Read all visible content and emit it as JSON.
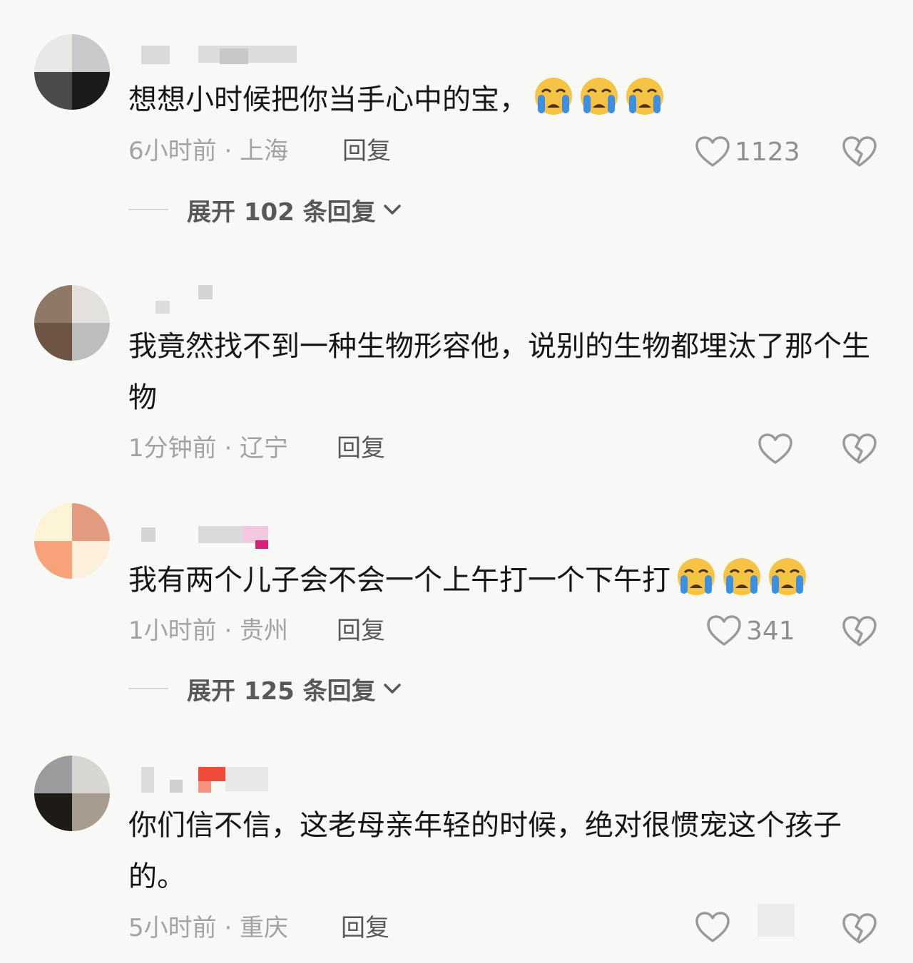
{
  "comments": [
    {
      "text": "想想小时候把你当手心中的宝，",
      "emoji_count": 3,
      "time": "6小时前",
      "location": "上海",
      "meta": "6小时前 · 上海",
      "reply_label": "回复",
      "like_count": "1123",
      "expand_label": "展开 102 条回复"
    },
    {
      "text": "我竟然找不到一种生物形容他，说别的生物都埋汰了那个生物",
      "emoji_count": 0,
      "time": "1分钟前",
      "location": "辽宁",
      "meta": "1分钟前 · 辽宁",
      "reply_label": "回复",
      "like_count": ""
    },
    {
      "text": "我有两个儿子会不会一个上午打一个下午打",
      "emoji_count": 3,
      "time": "1小时前",
      "location": "贵州",
      "meta": "1小时前 · 贵州",
      "reply_label": "回复",
      "like_count": "341",
      "expand_label": "展开 125 条回复"
    },
    {
      "text": "你们信不信，这老母亲年轻的时候，绝对很惯宠这个孩子的。",
      "emoji_count": 0,
      "time": "5小时前",
      "location": "重庆",
      "meta": "5小时前 · 重庆",
      "reply_label": "回复",
      "like_count": ""
    }
  ],
  "icons": {
    "like": "heart-outline-icon",
    "dislike": "broken-heart-icon",
    "expand": "chevron-down-icon",
    "emoji": "loudly-crying-face-emoji"
  },
  "colors": {
    "background": "#f8f8f6",
    "text": "#161616",
    "meta": "#a3a3a3",
    "reply": "#585858"
  }
}
